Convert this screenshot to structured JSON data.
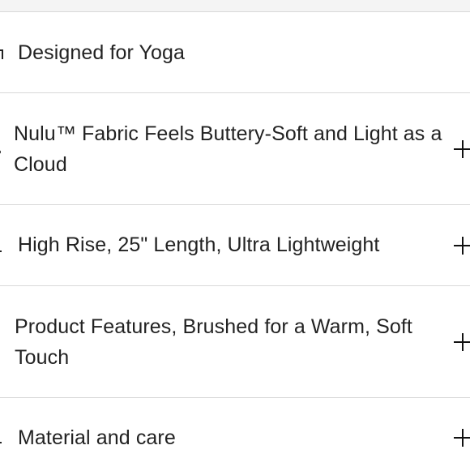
{
  "accordion": {
    "items": [
      {
        "label": "Designed for Yoga",
        "icon": "yoga-icon",
        "expandable": false
      },
      {
        "label": "Nulu™ Fabric Feels Buttery-Soft and Light as a Cloud",
        "icon": "fabric-icon",
        "expandable": true
      },
      {
        "label": "High Rise, 25\" Length, Ultra Lightweight",
        "icon": "fit-icon",
        "expandable": true
      },
      {
        "label": "Product Features, Brushed for a Warm, Soft Touch",
        "icon": "features-icon",
        "expandable": true
      },
      {
        "label": "Material and care",
        "icon": "care-icon",
        "expandable": true
      }
    ]
  }
}
